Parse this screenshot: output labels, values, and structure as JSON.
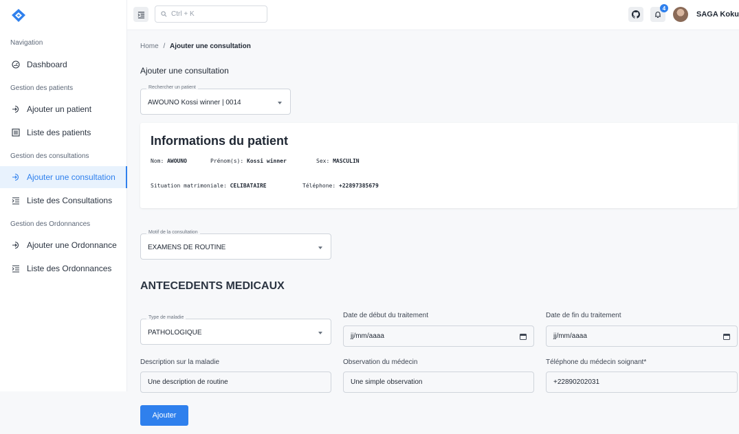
{
  "colors": {
    "accent": "#2f80ed",
    "badge": "#2f80ed"
  },
  "header": {
    "search_placeholder": "Ctrl + K",
    "notification_count": "4",
    "username": "SAGA Koku"
  },
  "sidebar": {
    "section_navigation": "Navigation",
    "dashboard": "Dashboard",
    "section_patients": "Gestion des patients",
    "add_patient": "Ajouter un patient",
    "list_patients": "Liste des patients",
    "section_consultations": "Gestion des consultations",
    "add_consultation": "Ajouter une consultation",
    "list_consultations": "Liste des Consultations",
    "section_ordonnances": "Gestion des Ordonnances",
    "add_ordonnance": "Ajouter une Ordonnance",
    "list_ordonnances": "Liste des Ordonnances"
  },
  "breadcrumb": {
    "home": "Home",
    "separator": "/",
    "current": "Ajouter une consultation"
  },
  "page_title": "Ajouter une consultation",
  "patient_search": {
    "label": "Rechercher un patient",
    "value": "AWOUNO Kossi winner | 0014"
  },
  "patient_info": {
    "title": "Informations du patient",
    "nom_label": "Nom:",
    "nom": "AWOUNO",
    "prenom_label": "Prénom(s):",
    "prenom": "Kossi winner",
    "sex_label": "Sex:",
    "sex": "MASCULIN",
    "situation_label": "Situation matrimoniale:",
    "situation": "CELIBATAIRE",
    "telephone_label": "Téléphone:",
    "telephone": "+22897385679"
  },
  "motif": {
    "label": "Motif de la consultation",
    "value": "EXAMENS DE ROUTINE"
  },
  "antecedents": {
    "title": "ANTECEDENTS MEDICAUX",
    "type_label": "Type de maladie",
    "type_value": "PATHOLOGIQUE",
    "date_debut_label": "Date de début du traitement",
    "date_debut_value": "jj/mm/aaaa",
    "date_fin_label": "Date de fin du traitement",
    "date_fin_value": "jj/mm/aaaa",
    "description_label": "Description sur la maladie",
    "description_value": "Une description de routine",
    "observation_label": "Observation du médecin",
    "observation_value": "Une simple observation",
    "tel_medecin_label": "Téléphone du médecin soignant*",
    "tel_medecin_value": "+22890202031"
  },
  "submit_label": "Ajouter"
}
